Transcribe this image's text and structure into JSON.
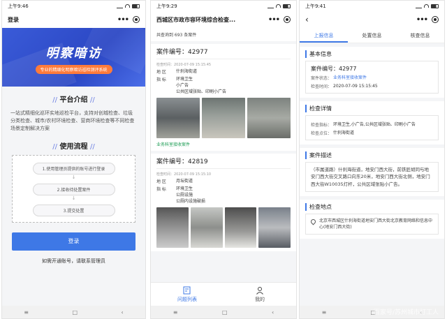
{
  "phone1": {
    "time": "上午9:46",
    "title": "登录",
    "banner_title": "明察暗访",
    "banner_sub": "专业的精细化明察暗访巡检测评系统",
    "section1": "平台介绍",
    "intro": "一站式精细化巡环实地巡检平台，支持对创城检查、垃圾分类检查、城市/农村环境检查、营商环境检查等不同检查场景定制解决方案",
    "section2": "使用流程",
    "steps": [
      "1.使用管理员提供的账号进行登录",
      "2.接收待处置案件",
      "3.提交处置"
    ],
    "login": "登录",
    "bottom": "如需开通账号，请联系管理员"
  },
  "phone2": {
    "time": "上午9:29",
    "title": "西城区市政市容环境综合检查...",
    "count": "共查询到 693 条案件",
    "cards": [
      {
        "case": "案件编号：42977",
        "time": "检查时间：2020-07-09 15:15:45",
        "area_k": "地 区",
        "area_v": "什刹海街道",
        "ind_k": "指 标",
        "ind_v": "环境卫生\n小广告\n公共区域张贴、印刷小广告",
        "status": "业务科室接收案件"
      },
      {
        "case": "案件编号：42819",
        "time": "检查时间：2020-07-09 15:15:10",
        "area_k": "地 区",
        "area_v": "月坛街道",
        "ind_k": "指 标",
        "ind_v": "环境卫生\n公厕设施\n公厕内设施破损"
      }
    ],
    "tab_list": "问题列表",
    "tab_me": "我的"
  },
  "phone3": {
    "time": "上午9:41",
    "tabs": [
      "上报信息",
      "处置信息",
      "核查信息"
    ],
    "basic_h": "基本信息",
    "case": "案件编号：42977",
    "status_k": "案件状态：",
    "status_v": "业务科室接收案件",
    "time_k": "检查时间：",
    "time_v": "2020-07-09 15:15:45",
    "detail_h": "检查详情",
    "ind_k": "检查指标：",
    "ind_v": "环境卫生,小广告,公共区域张贴、印刷小广告",
    "pt_k": "检查点位：",
    "pt_v": "什刹海街道",
    "desc_h": "案件描述",
    "desc": "（市属道路）什刹海街道，地安门西大街，前铁匠胡同与地安门西大街交叉路口向东20米，地安门西大街北侧，地安门西大街W10035灯杆，公共区域张贴小广告。",
    "place_h": "检查地点",
    "place": "北京市西城区什刹海街道地安门西大街北京教育网络和信息中心(地安门西大街)"
  },
  "nav": [
    "≡",
    "□",
    "‹"
  ],
  "watermark": "百家号/苏州城市打工人"
}
